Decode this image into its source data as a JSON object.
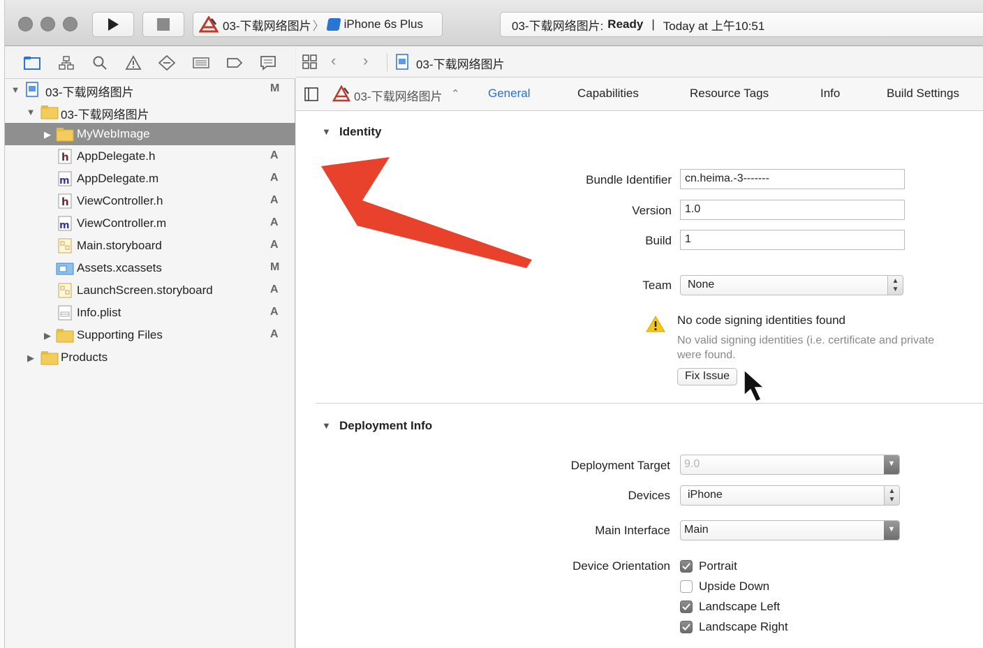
{
  "window": {
    "scheme_project": "03-下载网络图片",
    "scheme_device": "iPhone 6s Plus",
    "activity_project": "03-下载网络图片:",
    "activity_state": "Ready",
    "activity_separator": "|",
    "activity_time": "Today at 上午10:51"
  },
  "navigator": {
    "tree": [
      {
        "name": "03-下载网络图片",
        "status": "M"
      },
      {
        "name": "03-下载网络图片",
        "status": ""
      },
      {
        "name": "MyWebImage",
        "status": ""
      },
      {
        "name": "AppDelegate.h",
        "status": "A"
      },
      {
        "name": "AppDelegate.m",
        "status": "A"
      },
      {
        "name": "ViewController.h",
        "status": "A"
      },
      {
        "name": "ViewController.m",
        "status": "A"
      },
      {
        "name": "Main.storyboard",
        "status": "A"
      },
      {
        "name": "Assets.xcassets",
        "status": "M"
      },
      {
        "name": "LaunchScreen.storyboard",
        "status": "A"
      },
      {
        "name": "Info.plist",
        "status": "A"
      },
      {
        "name": "Supporting Files",
        "status": "A"
      },
      {
        "name": "Products",
        "status": ""
      }
    ]
  },
  "editor": {
    "jump_file": "03-下载网络图片",
    "target_name": "03-下载网络图片",
    "tabs": [
      "General",
      "Capabilities",
      "Resource Tags",
      "Info",
      "Build Settings"
    ],
    "accent_color": "#2a6fd6",
    "identity": {
      "title": "Identity",
      "bundle_label": "Bundle Identifier",
      "bundle_value": "cn.heima.-3-------",
      "version_label": "Version",
      "version_value": "1.0",
      "build_label": "Build",
      "build_value": "1",
      "team_label": "Team",
      "team_value": "None",
      "warning_title": "No code signing identities found",
      "warning_line1": "No valid signing identities (i.e. certificate and private",
      "warning_line2": "were found.",
      "fix_label": "Fix Issue"
    },
    "deployment": {
      "title": "Deployment Info",
      "target_label": "Deployment Target",
      "target_value": "9.0",
      "devices_label": "Devices",
      "devices_value": "iPhone",
      "interface_label": "Main Interface",
      "interface_value": "Main",
      "orientation_label": "Device Orientation",
      "orientations": [
        {
          "label": "Portrait",
          "checked": true
        },
        {
          "label": "Upside Down",
          "checked": false
        },
        {
          "label": "Landscape Left",
          "checked": true
        },
        {
          "label": "Landscape Right",
          "checked": true
        }
      ]
    }
  }
}
